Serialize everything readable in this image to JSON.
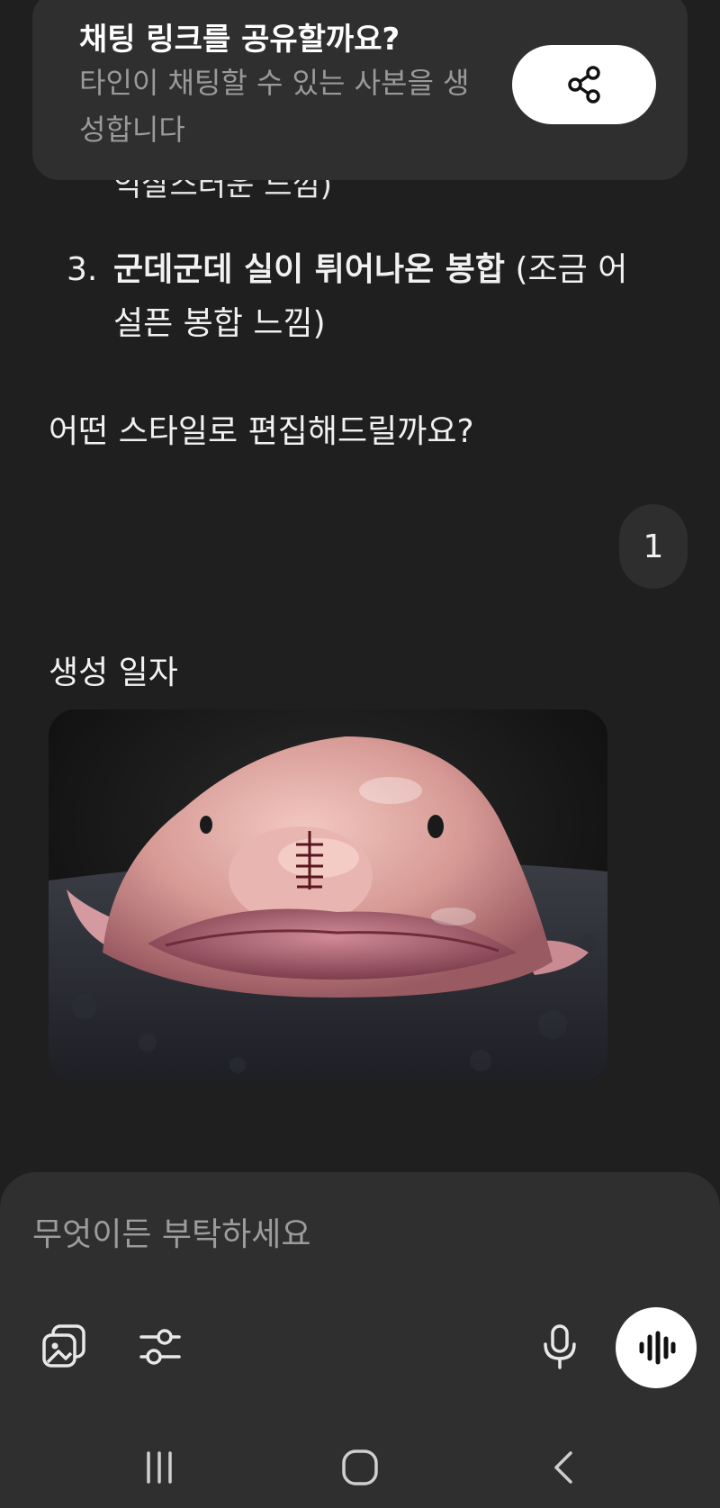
{
  "share_banner": {
    "title": "채팅 링크를 공유할까요?",
    "subtitle": "타인이 채팅할 수 있는 사본을 생성합니다",
    "share_icon": "share-icon"
  },
  "conversation": {
    "partial_line": "익살스러운 느낌)",
    "list_item": {
      "number": "3.",
      "bold_text": "군데군데 실이 튀어나온 봉합",
      "rest_text": " (조금 어설픈 봉합 느낌)"
    },
    "question": "어떤 스타일로 편집해드릴까요?",
    "user_reply": "1",
    "date_label": "생성 일자",
    "image_subject": "blobfish-with-stitches"
  },
  "composer": {
    "placeholder": "무엇이든 부탁하세요",
    "icons": [
      "image-gallery-icon",
      "settings-sliders-icon",
      "microphone-icon",
      "voice-mode-icon"
    ]
  },
  "navbar": {
    "icons": [
      "recent-apps-icon",
      "home-icon",
      "back-icon"
    ]
  },
  "colors": {
    "background": "#1f1f1f",
    "card": "#2f2f2f",
    "text": "#f1f1f1",
    "muted": "#9a9a9a",
    "button": "#ffffff"
  }
}
